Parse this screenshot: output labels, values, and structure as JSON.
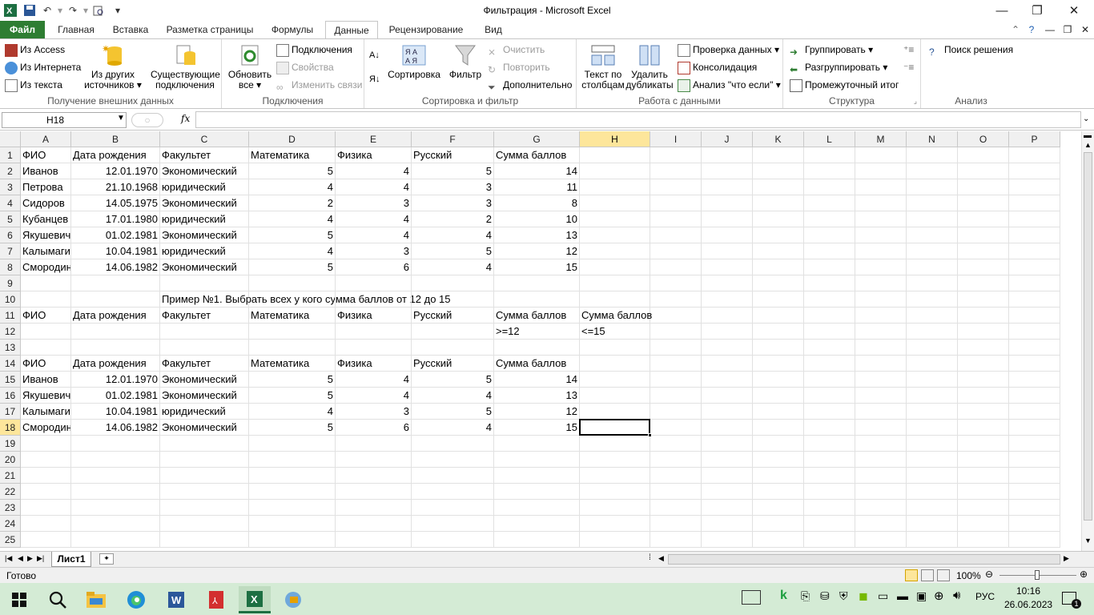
{
  "window": {
    "title": "Фильтрация  -  Microsoft Excel",
    "minimize": "—",
    "restore": "❐",
    "close": "✕"
  },
  "tabs": [
    "Файл",
    "Главная",
    "Вставка",
    "Разметка страницы",
    "Формулы",
    "Данные",
    "Рецензирование",
    "Вид"
  ],
  "ribbon": {
    "ext_data": {
      "label": "Получение внешних данных",
      "from_access": "Из Access",
      "from_web": "Из Интернета",
      "from_text": "Из текста",
      "from_other_1": "Из других",
      "from_other_2": "источников",
      "existing_1": "Существующие",
      "existing_2": "подключения"
    },
    "connections": {
      "label": "Подключения",
      "refresh_1": "Обновить",
      "refresh_2": "все",
      "connections": "Подключения",
      "properties": "Свойства",
      "edit_links": "Изменить связи"
    },
    "sort_filter": {
      "label": "Сортировка и фильтр",
      "sort": "Сортировка",
      "filter": "Фильтр",
      "clear": "Очистить",
      "reapply": "Повторить",
      "advanced": "Дополнительно"
    },
    "data_tools": {
      "label": "Работа с данными",
      "text_to_cols_1": "Текст по",
      "text_to_cols_2": "столбцам",
      "remove_dup_1": "Удалить",
      "remove_dup_2": "дубликаты",
      "validation": "Проверка данных",
      "consolidate": "Консолидация",
      "whatif": "Анализ \"что если\""
    },
    "outline": {
      "label": "Структура",
      "group": "Группировать",
      "ungroup": "Разгруппировать",
      "subtotal": "Промежуточный итог"
    },
    "analysis": {
      "label": "Анализ",
      "solver": "Поиск решения"
    }
  },
  "formula_bar": {
    "name_box": "H18",
    "fx": "fx",
    "formula": ""
  },
  "columns": [
    "A",
    "B",
    "C",
    "D",
    "E",
    "F",
    "G",
    "H",
    "I",
    "J",
    "K",
    "L",
    "M",
    "N",
    "O",
    "P"
  ],
  "selected_column": "H",
  "selected_row": 18,
  "rows": [
    "1",
    "2",
    "3",
    "4",
    "5",
    "6",
    "7",
    "8",
    "9",
    "10",
    "11",
    "12",
    "13",
    "14",
    "15",
    "16",
    "17",
    "18",
    "19",
    "20",
    "21",
    "22",
    "23",
    "24",
    "25"
  ],
  "cells": {
    "r1": [
      "ФИО",
      "Дата рождения",
      "Факультет",
      "Математика",
      "Физика",
      "Русский",
      "Сумма баллов"
    ],
    "r2": [
      "Иванов",
      "12.01.1970",
      "Экономический",
      "5",
      "4",
      "5",
      "14"
    ],
    "r3": [
      "Петрова",
      "21.10.1968",
      "юридический",
      "4",
      "4",
      "3",
      "11"
    ],
    "r4": [
      "Сидоров",
      "14.05.1975",
      "Экономический",
      "2",
      "3",
      "3",
      "8"
    ],
    "r5": [
      "Кубанцев",
      "17.01.1980",
      "юридический",
      "4",
      "4",
      "2",
      "10"
    ],
    "r6": [
      "Якушевич",
      "01.02.1981",
      "Экономический",
      "5",
      "4",
      "4",
      "13"
    ],
    "r7": [
      "Калымагин",
      "10.04.1981",
      "юридический",
      "4",
      "3",
      "5",
      "12"
    ],
    "r8": [
      "Смородин",
      "14.06.1982",
      "Экономический",
      "5",
      "6",
      "4",
      "15"
    ],
    "r10_c": "Пример №1. Выбрать всех у кого сумма баллов от 12 до 15",
    "r11": [
      "ФИО",
      "Дата рождения",
      "Факультет",
      "Математика",
      "Физика",
      "Русский",
      "Сумма баллов",
      "Сумма баллов"
    ],
    "r12_g": ">=12",
    "r12_h": "<=15",
    "r14": [
      "ФИО",
      "Дата рождения",
      "Факультет",
      "Математика",
      "Физика",
      "Русский",
      "Сумма баллов"
    ],
    "r15": [
      "Иванов",
      "12.01.1970",
      "Экономический",
      "5",
      "4",
      "5",
      "14"
    ],
    "r16": [
      "Якушевич",
      "01.02.1981",
      "Экономический",
      "5",
      "4",
      "4",
      "13"
    ],
    "r17": [
      "Калымагин",
      "10.04.1981",
      "юридический",
      "4",
      "3",
      "5",
      "12"
    ],
    "r18": [
      "Смородин",
      "14.06.1982",
      "Экономический",
      "5",
      "6",
      "4",
      "15"
    ]
  },
  "sheet_tab": "Лист1",
  "status": {
    "ready": "Готово",
    "zoom": "100%"
  },
  "taskbar": {
    "lang": "РУС",
    "time": "10:16",
    "date": "26.06.2023",
    "notif": "1"
  },
  "colors": {
    "file_tab": "#2e7d32",
    "selected_header": "#fde69b",
    "taskbar": "#d4ebd5"
  }
}
